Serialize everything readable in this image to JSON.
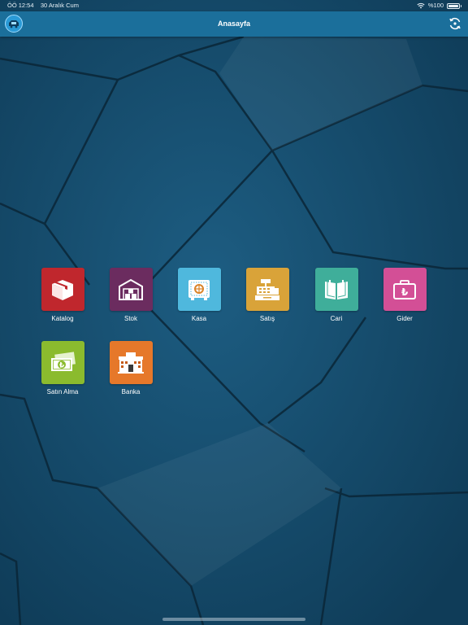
{
  "status": {
    "time": "ÖÖ 12:54",
    "date": "30 Aralık Cum",
    "battery": "%100"
  },
  "nav": {
    "title": "Anasayfa",
    "left_icon": "app-logo-icon",
    "right_icon": "sync-icon"
  },
  "tiles": [
    {
      "label": "Katalog",
      "color": "#c0272d",
      "icon": "box-icon"
    },
    {
      "label": "Stok",
      "color": "#6b2c5f",
      "icon": "warehouse-icon"
    },
    {
      "label": "Kasa",
      "color": "#4fb8dd",
      "icon": "safe-icon"
    },
    {
      "label": "Satış",
      "color": "#d9a339",
      "icon": "cash-register-icon"
    },
    {
      "label": "Cari",
      "color": "#3fae9a",
      "icon": "book-icon"
    },
    {
      "label": "Gider",
      "color": "#d34f96",
      "icon": "briefcase-lira-icon"
    },
    {
      "label": "Satın Alma",
      "color": "#8bbb2e",
      "icon": "lira-banknote-icon"
    },
    {
      "label": "Banka",
      "color": "#e6782a",
      "icon": "bank-building-icon"
    }
  ]
}
